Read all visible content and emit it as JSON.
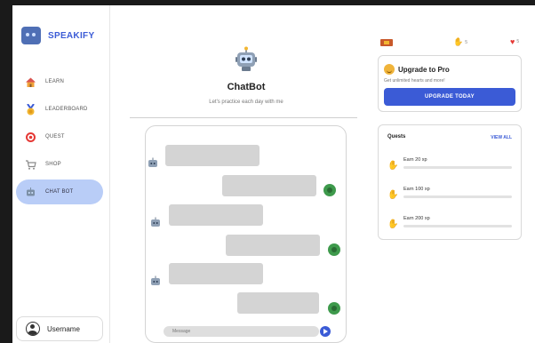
{
  "brand": {
    "name": "SPEAKIFY",
    "icon": "robot-logo-icon"
  },
  "sidebar": {
    "items": [
      {
        "label": "LEARN",
        "icon": "home-icon"
      },
      {
        "label": "LEADERBOARD",
        "icon": "medal-icon"
      },
      {
        "label": "QUEST",
        "icon": "target-icon"
      },
      {
        "label": "SHOP",
        "icon": "cart-icon"
      },
      {
        "label": "CHAT BOT",
        "icon": "robot-icon",
        "active": true
      }
    ],
    "user": {
      "name": "Username",
      "icon": "user-avatar-icon"
    }
  },
  "chat": {
    "title": "ChatBot",
    "subtitle": "Let's practice each day with me",
    "input_placeholder": "Message",
    "send_icon": "send-icon"
  },
  "stats": {
    "flag_icon": "sri-lanka-flag-icon",
    "streak_icon": "flame-icon",
    "streak_value": "5",
    "hearts_icon": "heart-icon",
    "hearts_value": "5"
  },
  "pro": {
    "title": "Upgrade to Pro",
    "subtitle": "Get unlimited hearts and more!",
    "button": "UPGRADE TODAY"
  },
  "quests": {
    "title": "Quests",
    "view_all": "VIEW ALL",
    "items": [
      {
        "label": "Earn 20 xp",
        "progress": 0
      },
      {
        "label": "Earn 100 xp",
        "progress": 0
      },
      {
        "label": "Earn 200 xp",
        "progress": 0
      }
    ]
  },
  "colors": {
    "accent": "#3b5bd6",
    "active_nav": "#b9cdf7",
    "bubble": "#d4d4d4",
    "user_avatar": "#3e9a4c",
    "heart": "#e53935"
  }
}
